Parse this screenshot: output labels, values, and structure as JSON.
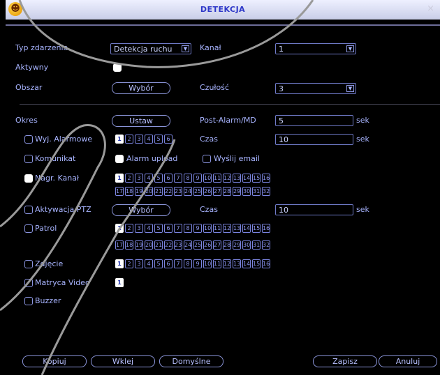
{
  "window": {
    "title": "DETEKCJA",
    "logo_glyph": "☻",
    "close_glyph": "×"
  },
  "form": {
    "event_type": {
      "label": "Typ zdarzenia",
      "value": "Detekcja ruchu"
    },
    "channel": {
      "label": "Kanał",
      "value": "1"
    },
    "active": {
      "label": "Aktywny",
      "checked": true
    },
    "region": {
      "label": "Obszar",
      "button": "Wybór"
    },
    "sensitivity": {
      "label": "Czułość",
      "value": "3"
    },
    "period": {
      "label": "Okres",
      "button": "Ustaw"
    },
    "post_alarm": {
      "label": "Post-Alarm/MD",
      "value": "5",
      "unit": "sek"
    },
    "alarm_out": {
      "label": "Wyj. Alarmowe",
      "checked": false,
      "numbers": [
        "1",
        "2",
        "3",
        "4",
        "5",
        "6"
      ],
      "selected": [
        "1"
      ]
    },
    "alarm_time": {
      "label": "Czas",
      "value": "10",
      "unit": "sek"
    },
    "message": {
      "label": "Komunikat",
      "checked": false
    },
    "alarm_upload": {
      "label": "Alarm upload",
      "checked": true
    },
    "send_email": {
      "label": "Wyślij email",
      "checked": false
    },
    "rec_channel": {
      "label": "Nagr. Kanał",
      "checked": true,
      "row1": [
        "1",
        "2",
        "3",
        "4",
        "5",
        "6",
        "7",
        "8",
        "9",
        "10",
        "11",
        "12",
        "13",
        "14",
        "15",
        "16"
      ],
      "row2": [
        "17",
        "18",
        "19",
        "20",
        "21",
        "22",
        "23",
        "24",
        "25",
        "26",
        "27",
        "28",
        "29",
        "30",
        "31",
        "32"
      ],
      "selected": [
        "1"
      ]
    },
    "ptz": {
      "label": "Aktywacja PTZ",
      "checked": false,
      "button": "Wybór"
    },
    "ptz_time": {
      "label": "Czas",
      "value": "10",
      "unit": "sek"
    },
    "tour": {
      "label": "Patrol",
      "checked": false,
      "row1": [
        "1",
        "2",
        "3",
        "4",
        "5",
        "6",
        "7",
        "8",
        "9",
        "10",
        "11",
        "12",
        "13",
        "14",
        "15",
        "16"
      ],
      "row2": [
        "17",
        "18",
        "19",
        "20",
        "21",
        "22",
        "23",
        "24",
        "25",
        "26",
        "27",
        "28",
        "29",
        "30",
        "31",
        "32"
      ],
      "selected": [
        "1"
      ]
    },
    "snapshot": {
      "label": "Zdjęcie",
      "checked": false,
      "row1": [
        "1",
        "2",
        "3",
        "4",
        "5",
        "6",
        "7",
        "8",
        "9",
        "10",
        "11",
        "12",
        "13",
        "14",
        "15",
        "16"
      ],
      "selected": [
        "1"
      ]
    },
    "video_matrix": {
      "label": "Matryca Video",
      "checked": false,
      "numbers": [
        "1"
      ],
      "selected": [
        "1"
      ]
    },
    "buzzer": {
      "label": "Buzzer",
      "checked": false
    }
  },
  "footer": {
    "copy": "Kopiuj",
    "paste": "Wklej",
    "default": "Domyślne",
    "save": "Zapisz",
    "cancel": "Anuluj"
  },
  "colors": {
    "label": "#a8b4ff",
    "border": "#6f7ac8",
    "checked": "#ffffff",
    "title": "#2d37c8"
  }
}
